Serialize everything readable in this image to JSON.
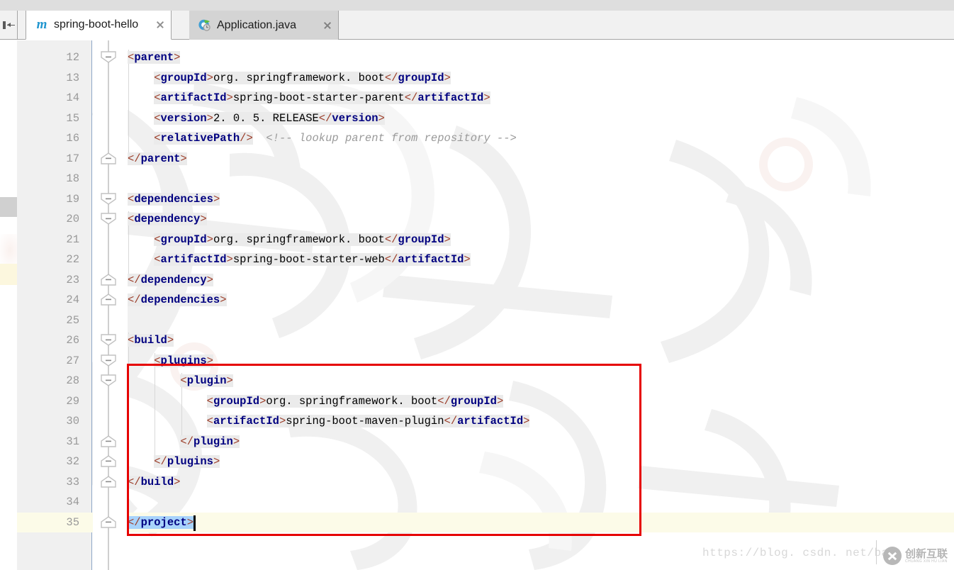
{
  "window": {
    "hide_sidebar_icon": "collapse-left-icon"
  },
  "tabs": [
    {
      "label": "spring-boot-hello",
      "icon": "maven-m-icon",
      "close_icon": "close-icon",
      "active": true
    },
    {
      "label": "Application.java",
      "icon": "spring-boot-run-class-icon",
      "close_icon": "close-icon",
      "active": false
    }
  ],
  "editor": {
    "first_line": 12,
    "last_line": 35,
    "current_line": 35,
    "selection_text": "</project>",
    "line_numbers": [
      "12",
      "13",
      "14",
      "15",
      "16",
      "17",
      "18",
      "19",
      "20",
      "21",
      "22",
      "23",
      "24",
      "25",
      "26",
      "27",
      "28",
      "29",
      "30",
      "31",
      "32",
      "33",
      "34",
      "35"
    ],
    "lines": [
      {
        "n": "12",
        "indent": 0,
        "segments": [
          {
            "t": "br",
            "v": "<"
          },
          {
            "t": "tg",
            "v": "parent"
          },
          {
            "t": "br",
            "v": ">"
          }
        ],
        "fold": "start"
      },
      {
        "n": "13",
        "indent": 1,
        "segments": [
          {
            "t": "br",
            "v": "<"
          },
          {
            "t": "tg",
            "v": "groupId"
          },
          {
            "t": "br",
            "v": ">"
          },
          {
            "t": "txt",
            "v": "org. springframework. boot"
          },
          {
            "t": "br",
            "v": "</"
          },
          {
            "t": "tg",
            "v": "groupId"
          },
          {
            "t": "br",
            "v": ">"
          }
        ],
        "fold": "none"
      },
      {
        "n": "14",
        "indent": 1,
        "segments": [
          {
            "t": "br",
            "v": "<"
          },
          {
            "t": "tg",
            "v": "artifactId"
          },
          {
            "t": "br",
            "v": ">"
          },
          {
            "t": "txt",
            "v": "spring-boot-starter-parent"
          },
          {
            "t": "br",
            "v": "</"
          },
          {
            "t": "tg",
            "v": "artifactId"
          },
          {
            "t": "br",
            "v": ">"
          }
        ],
        "fold": "none"
      },
      {
        "n": "15",
        "indent": 1,
        "segments": [
          {
            "t": "br",
            "v": "<"
          },
          {
            "t": "tg",
            "v": "version"
          },
          {
            "t": "br",
            "v": ">"
          },
          {
            "t": "txt",
            "v": "2. 0. 5. RELEASE"
          },
          {
            "t": "br",
            "v": "</"
          },
          {
            "t": "tg",
            "v": "version"
          },
          {
            "t": "br",
            "v": ">"
          }
        ],
        "fold": "none"
      },
      {
        "n": "16",
        "indent": 1,
        "segments": [
          {
            "t": "br",
            "v": "<"
          },
          {
            "t": "tg",
            "v": "relativePath"
          },
          {
            "t": "br",
            "v": "/>"
          },
          {
            "t": "plain",
            "v": "  "
          },
          {
            "t": "cmt",
            "v": "<!-- lookup parent from repository -->"
          }
        ],
        "fold": "none"
      },
      {
        "n": "17",
        "indent": 0,
        "segments": [
          {
            "t": "br",
            "v": "</"
          },
          {
            "t": "tg",
            "v": "parent"
          },
          {
            "t": "br",
            "v": ">"
          }
        ],
        "fold": "end"
      },
      {
        "n": "18",
        "indent": 0,
        "segments": [],
        "fold": "none"
      },
      {
        "n": "19",
        "indent": 0,
        "segments": [
          {
            "t": "br",
            "v": "<"
          },
          {
            "t": "tg",
            "v": "dependencies"
          },
          {
            "t": "br",
            "v": ">"
          }
        ],
        "fold": "start"
      },
      {
        "n": "20",
        "indent": 0,
        "segments": [
          {
            "t": "br",
            "v": "<"
          },
          {
            "t": "tg",
            "v": "dependency"
          },
          {
            "t": "br",
            "v": ">"
          }
        ],
        "fold": "start"
      },
      {
        "n": "21",
        "indent": 1,
        "segments": [
          {
            "t": "br",
            "v": "<"
          },
          {
            "t": "tg",
            "v": "groupId"
          },
          {
            "t": "br",
            "v": ">"
          },
          {
            "t": "txt",
            "v": "org. springframework. boot"
          },
          {
            "t": "br",
            "v": "</"
          },
          {
            "t": "tg",
            "v": "groupId"
          },
          {
            "t": "br",
            "v": ">"
          }
        ],
        "fold": "none"
      },
      {
        "n": "22",
        "indent": 1,
        "segments": [
          {
            "t": "br",
            "v": "<"
          },
          {
            "t": "tg",
            "v": "artifactId"
          },
          {
            "t": "br",
            "v": ">"
          },
          {
            "t": "txt",
            "v": "spring-boot-starter-web"
          },
          {
            "t": "br",
            "v": "</"
          },
          {
            "t": "tg",
            "v": "artifactId"
          },
          {
            "t": "br",
            "v": ">"
          }
        ],
        "fold": "none"
      },
      {
        "n": "23",
        "indent": 0,
        "segments": [
          {
            "t": "br",
            "v": "</"
          },
          {
            "t": "tg",
            "v": "dependency"
          },
          {
            "t": "br",
            "v": ">"
          }
        ],
        "fold": "end"
      },
      {
        "n": "24",
        "indent": 0,
        "segments": [
          {
            "t": "br",
            "v": "</"
          },
          {
            "t": "tg",
            "v": "dependencies"
          },
          {
            "t": "br",
            "v": ">"
          }
        ],
        "fold": "end"
      },
      {
        "n": "25",
        "indent": 0,
        "segments": [],
        "fold": "none"
      },
      {
        "n": "26",
        "indent": 0,
        "segments": [
          {
            "t": "br",
            "v": "<"
          },
          {
            "t": "tg",
            "v": "build"
          },
          {
            "t": "br",
            "v": ">"
          }
        ],
        "fold": "start"
      },
      {
        "n": "27",
        "indent": 1,
        "segments": [
          {
            "t": "br",
            "v": "<"
          },
          {
            "t": "tg",
            "v": "plugins"
          },
          {
            "t": "br",
            "v": ">"
          }
        ],
        "fold": "start"
      },
      {
        "n": "28",
        "indent": 2,
        "segments": [
          {
            "t": "br",
            "v": "<"
          },
          {
            "t": "tg",
            "v": "plugin"
          },
          {
            "t": "br",
            "v": ">"
          }
        ],
        "fold": "start"
      },
      {
        "n": "29",
        "indent": 3,
        "segments": [
          {
            "t": "br",
            "v": "<"
          },
          {
            "t": "tg",
            "v": "groupId"
          },
          {
            "t": "br",
            "v": ">"
          },
          {
            "t": "txt",
            "v": "org. springframework. boot"
          },
          {
            "t": "br",
            "v": "</"
          },
          {
            "t": "tg",
            "v": "groupId"
          },
          {
            "t": "br",
            "v": ">"
          }
        ],
        "fold": "none"
      },
      {
        "n": "30",
        "indent": 3,
        "segments": [
          {
            "t": "br",
            "v": "<"
          },
          {
            "t": "tg",
            "v": "artifactId"
          },
          {
            "t": "br",
            "v": ">"
          },
          {
            "t": "txt",
            "v": "spring-boot-maven-plugin"
          },
          {
            "t": "br",
            "v": "</"
          },
          {
            "t": "tg",
            "v": "artifactId"
          },
          {
            "t": "br",
            "v": ">"
          }
        ],
        "fold": "none"
      },
      {
        "n": "31",
        "indent": 2,
        "segments": [
          {
            "t": "br",
            "v": "</"
          },
          {
            "t": "tg",
            "v": "plugin"
          },
          {
            "t": "br",
            "v": ">"
          }
        ],
        "fold": "end"
      },
      {
        "n": "32",
        "indent": 1,
        "segments": [
          {
            "t": "br",
            "v": "</"
          },
          {
            "t": "tg",
            "v": "plugins"
          },
          {
            "t": "br",
            "v": ">"
          }
        ],
        "fold": "end"
      },
      {
        "n": "33",
        "indent": 0,
        "segments": [
          {
            "t": "br",
            "v": "</"
          },
          {
            "t": "tg",
            "v": "build"
          },
          {
            "t": "br",
            "v": ">"
          }
        ],
        "fold": "end"
      },
      {
        "n": "34",
        "indent": 0,
        "segments": [],
        "fold": "none"
      },
      {
        "n": "35",
        "indent": 0,
        "segments": [
          {
            "t": "sel-br",
            "v": "</"
          },
          {
            "t": "sel-tg",
            "v": "project"
          },
          {
            "t": "sel-br",
            "v": ">"
          }
        ],
        "fold": "end",
        "current": true
      }
    ],
    "annotation_box": {
      "label": "red-highlight-box",
      "color": "#e60000",
      "covers_lines": "26-33"
    }
  },
  "watermark": {
    "url": "https://blog. csdn. net/ban",
    "logo_cn": "创新互联",
    "logo_pinyin": "CHUANG XIN HU LIAN"
  },
  "colors": {
    "tag_name": "#000080",
    "bracket": "#9c3e2a",
    "comment": "#9a9a9a",
    "selection": "#a8d3fb",
    "current_line": "#fcfbe8",
    "annotation": "#e60000",
    "gutter_bg": "#f0f0f0",
    "tab_active_bg": "#ffffff",
    "tab_inactive_bg": "#d4d4d4"
  }
}
